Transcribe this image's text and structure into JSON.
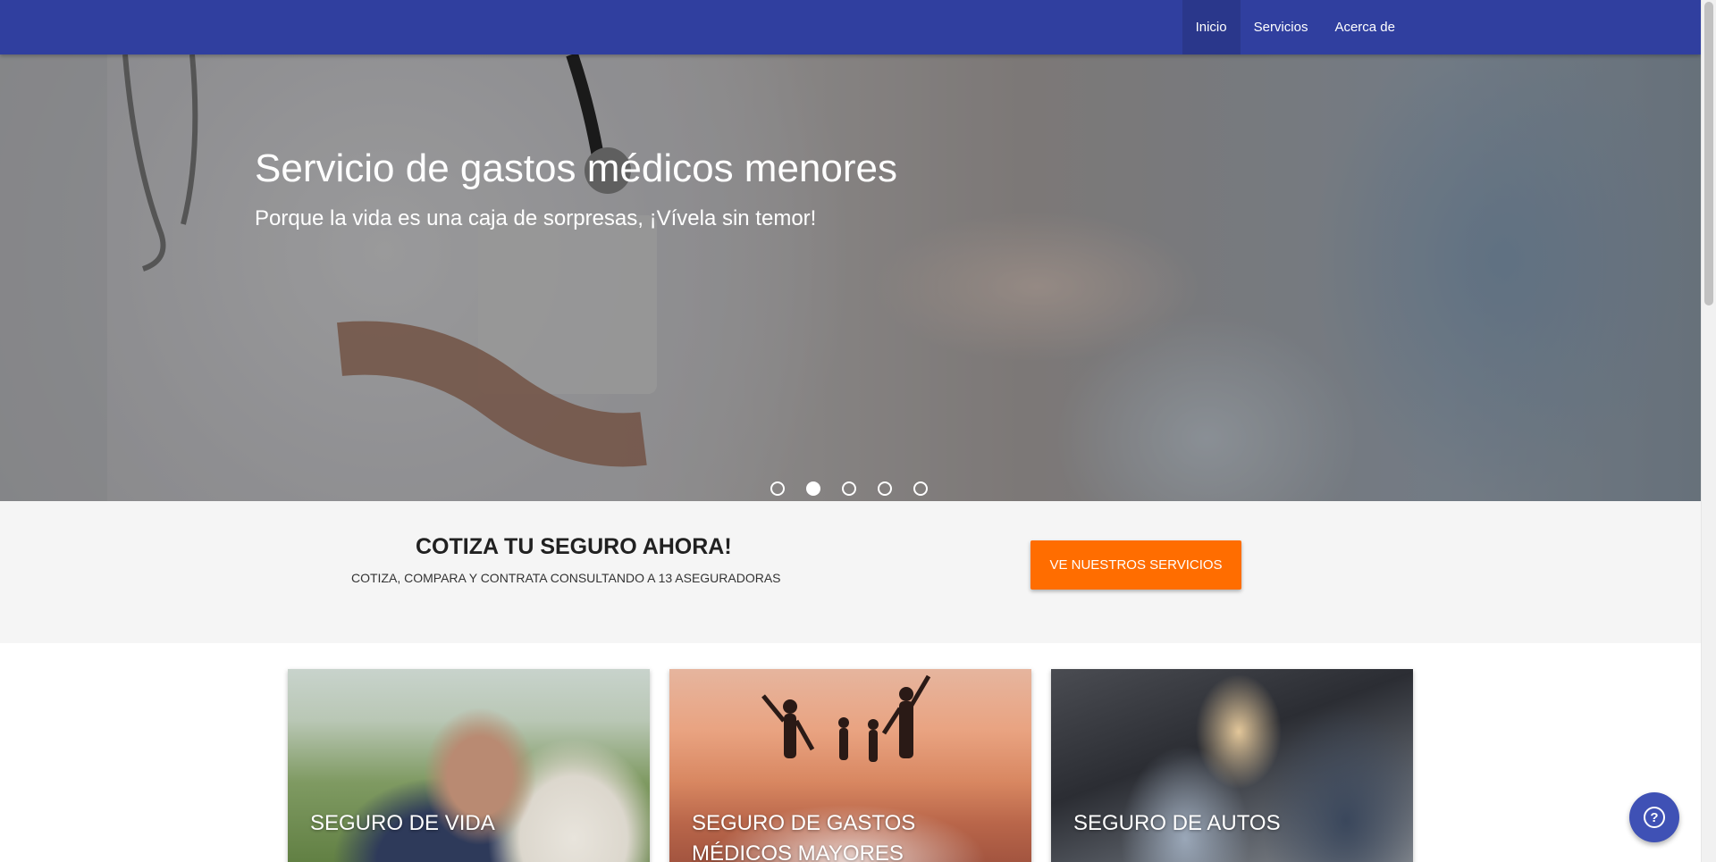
{
  "nav": {
    "items": [
      {
        "label": "Inicio",
        "active": true
      },
      {
        "label": "Servicios",
        "active": false
      },
      {
        "label": "Acerca de",
        "active": false
      }
    ]
  },
  "hero": {
    "title": "Servicio de gastos médicos menores",
    "subtitle": "Porque la vida es una caja de sorpresas, ¡Vívela sin temor!",
    "slides_count": 5,
    "active_slide": 2
  },
  "cta": {
    "title": "COTIZA TU SEGURO AHORA!",
    "subtitle": "COTIZA, COMPARA Y CONTRATA CONSULTANDO A 13 ASEGURADORAS",
    "button_label": "VE NUESTROS SERVICIOS"
  },
  "cards": [
    {
      "title": "SEGURO DE VIDA"
    },
    {
      "title": "SEGURO DE GASTOS MÉDICOS MAYORES"
    },
    {
      "title": "SEGURO DE AUTOS"
    }
  ],
  "help": {
    "icon": "help-circle-icon"
  },
  "colors": {
    "header": "#303f9f",
    "accent": "#ff6d00",
    "fab": "#3f51b5"
  }
}
